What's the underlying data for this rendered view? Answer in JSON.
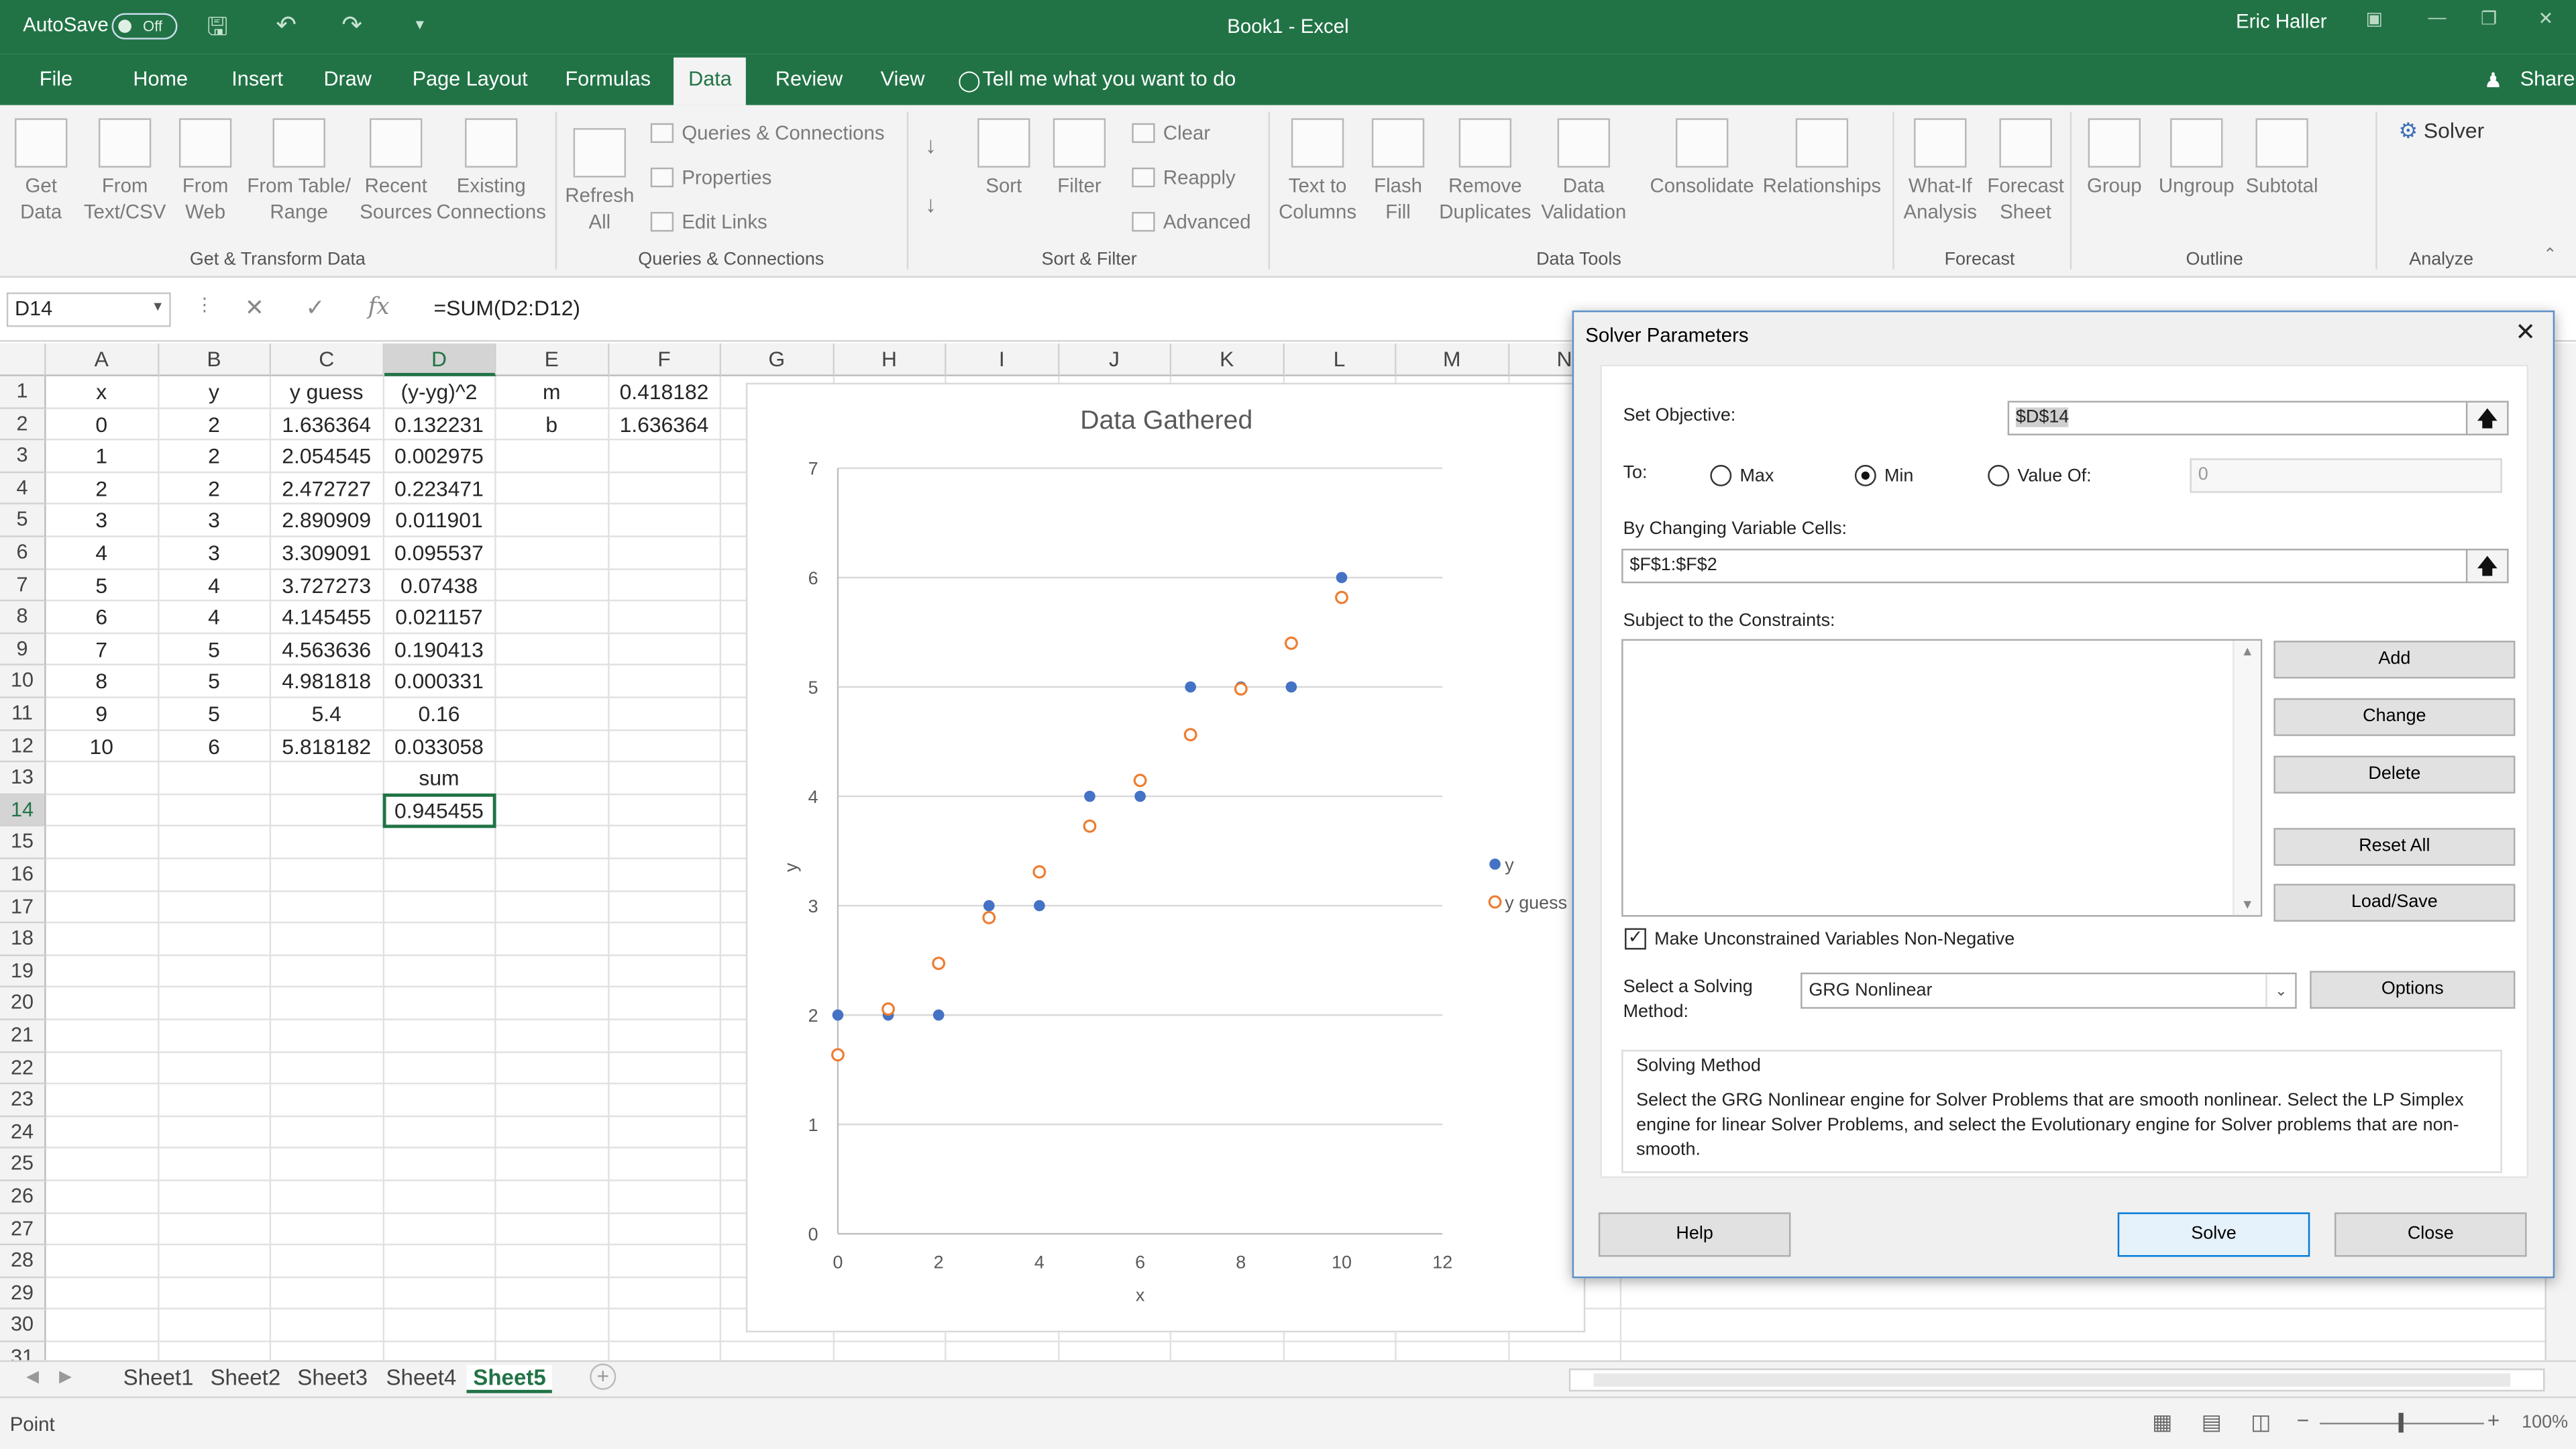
{
  "window": {
    "title": "Book1  -  Excel",
    "user": "Eric Haller",
    "autosave_label": "AutoSave",
    "autosave_state": "Off"
  },
  "tabs": [
    "File",
    "Home",
    "Insert",
    "Draw",
    "Page Layout",
    "Formulas",
    "Data",
    "Review",
    "View"
  ],
  "tell_me": "Tell me what you want to do",
  "share": "Share",
  "ribbon": {
    "get_data": "Get\nData",
    "from_text": "From\nText/CSV",
    "from_web": "From\nWeb",
    "from_table": "From Table/\nRange",
    "recent_sources": "Recent\nSources",
    "existing_connections": "Existing\nConnections",
    "refresh_all": "Refresh\nAll",
    "queries_connections": "Queries & Connections",
    "properties": "Properties",
    "edit_links": "Edit Links",
    "sort": "Sort",
    "filter": "Filter",
    "clear": "Clear",
    "reapply": "Reapply",
    "advanced": "Advanced",
    "text_to_columns": "Text to\nColumns",
    "flash_fill": "Flash\nFill",
    "remove_duplicates": "Remove\nDuplicates",
    "data_validation": "Data\nValidation",
    "consolidate": "Consolidate",
    "relationships": "Relationships",
    "what_if": "What-If\nAnalysis",
    "forecast_sheet": "Forecast\nSheet",
    "group": "Group",
    "ungroup": "Ungroup",
    "subtotal": "Subtotal",
    "solver": "Solver",
    "groups": [
      "Get & Transform Data",
      "Queries & Connections",
      "Sort & Filter",
      "Data Tools",
      "Forecast",
      "Outline",
      "Analyze"
    ]
  },
  "formula_bar": {
    "name_box": "D14",
    "formula": "=SUM(D2:D12)"
  },
  "columns": [
    "A",
    "B",
    "C",
    "D",
    "E",
    "F",
    "G",
    "H",
    "I",
    "J",
    "K",
    "L",
    "M",
    "N"
  ],
  "rows": [
    "1",
    "2",
    "3",
    "4",
    "5",
    "6",
    "7",
    "8",
    "9",
    "10",
    "11",
    "12",
    "13",
    "14",
    "15",
    "16",
    "17",
    "18",
    "19",
    "20",
    "21",
    "22",
    "23",
    "24",
    "25",
    "26",
    "27",
    "28",
    "29",
    "30",
    "31"
  ],
  "grid": {
    "header": [
      "x",
      "y",
      "y guess",
      "(y-yg)^2"
    ],
    "data": [
      [
        "0",
        "2",
        "1.636364",
        "0.132231"
      ],
      [
        "1",
        "2",
        "2.054545",
        "0.002975"
      ],
      [
        "2",
        "2",
        "2.472727",
        "0.223471"
      ],
      [
        "3",
        "3",
        "2.890909",
        "0.011901"
      ],
      [
        "4",
        "3",
        "3.309091",
        "0.095537"
      ],
      [
        "5",
        "4",
        "3.727273",
        "0.07438"
      ],
      [
        "6",
        "4",
        "4.145455",
        "0.021157"
      ],
      [
        "7",
        "5",
        "4.563636",
        "0.190413"
      ],
      [
        "8",
        "5",
        "4.981818",
        "0.000331"
      ],
      [
        "9",
        "5",
        "5.4",
        "0.16"
      ],
      [
        "10",
        "6",
        "5.818182",
        "0.033058"
      ]
    ],
    "sum_label": "sum",
    "sum_value": "0.945455",
    "param_labels": [
      "m",
      "b"
    ],
    "param_values": [
      "0.418182",
      "1.636364"
    ]
  },
  "chart_data": {
    "type": "scatter",
    "title": "Data Gathered",
    "xlabel": "x",
    "ylabel": "y",
    "xlim": [
      0,
      12
    ],
    "ylim": [
      0,
      7
    ],
    "xticks": [
      "0",
      "2",
      "4",
      "6",
      "8",
      "10",
      "12"
    ],
    "yticks": [
      "0",
      "1",
      "2",
      "3",
      "4",
      "5",
      "6",
      "7"
    ],
    "grid": "horizontal",
    "legend": "right",
    "series": [
      {
        "name": "y",
        "color": "#4472c4",
        "marker": "filled",
        "x": [
          0,
          1,
          2,
          3,
          4,
          5,
          6,
          7,
          8,
          9,
          10
        ],
        "y": [
          2,
          2,
          2,
          3,
          3,
          4,
          4,
          5,
          5,
          5,
          6
        ]
      },
      {
        "name": "y guess",
        "color": "#ed7d31",
        "marker": "hollow",
        "x": [
          0,
          1,
          2,
          3,
          4,
          5,
          6,
          7,
          8,
          9,
          10
        ],
        "y": [
          1.636364,
          2.054545,
          2.472727,
          2.890909,
          3.309091,
          3.727273,
          4.145455,
          4.563636,
          4.981818,
          5.4,
          5.818182
        ]
      }
    ]
  },
  "sheets": [
    "Sheet1",
    "Sheet2",
    "Sheet3",
    "Sheet4",
    "Sheet5"
  ],
  "active_sheet": "Sheet5",
  "status": {
    "mode": "Point",
    "zoom": "100%"
  },
  "dialog": {
    "title": "Solver Parameters",
    "set_objective_label": "Set Objective:",
    "objective": "$D$14",
    "to_label": "To:",
    "max": "Max",
    "min": "Min",
    "value_of": "Value Of:",
    "value": "0",
    "changing_label": "By Changing Variable Cells:",
    "changing": "$F$1:$F$2",
    "constraints_label": "Subject to the Constraints:",
    "add": "Add",
    "change": "Change",
    "delete": "Delete",
    "reset_all": "Reset All",
    "load_save": "Load/Save",
    "nonneg": "Make Unconstrained Variables Non-Negative",
    "method_label": "Select a Solving\nMethod:",
    "method": "GRG Nonlinear",
    "options": "Options",
    "solving_method_title": "Solving Method",
    "solving_method_desc": "Select the GRG Nonlinear engine for Solver Problems that are smooth nonlinear. Select the LP Simplex engine for linear Solver Problems, and select the Evolutionary engine for Solver problems that are non-smooth.",
    "help": "Help",
    "solve": "Solve",
    "close": "Close"
  }
}
